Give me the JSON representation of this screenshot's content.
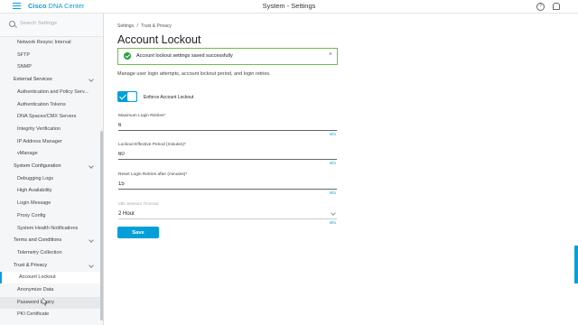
{
  "app": {
    "logo_brand": "Cisco",
    "logo_product": "DNA Center",
    "title": "System - Settings",
    "help_glyph": "?",
    "colors": {
      "accent": "#049fd9",
      "success": "#2c9d3c"
    }
  },
  "sidebar": {
    "search_placeholder": "Search Settings",
    "items": [
      {
        "label": "Network Resync Interval",
        "type": "sub"
      },
      {
        "label": "SFTP",
        "type": "sub"
      },
      {
        "label": "SNMP",
        "type": "sub"
      },
      {
        "label": "External Services",
        "type": "group"
      },
      {
        "label": "Authentication and Policy Serv...",
        "type": "sub"
      },
      {
        "label": "Authentication Tokens",
        "type": "sub"
      },
      {
        "label": "DNA Spaces/CMX Servers",
        "type": "sub"
      },
      {
        "label": "Integrity Verification",
        "type": "sub"
      },
      {
        "label": "IP Address Manager",
        "type": "sub"
      },
      {
        "label": "vManage",
        "type": "sub"
      },
      {
        "label": "System Configuration",
        "type": "group"
      },
      {
        "label": "Debugging Logs",
        "type": "sub"
      },
      {
        "label": "High Availability",
        "type": "sub"
      },
      {
        "label": "Login Message",
        "type": "sub"
      },
      {
        "label": "Proxy Config",
        "type": "sub"
      },
      {
        "label": "System Health Notifications",
        "type": "sub"
      },
      {
        "label": "Terms and Conditions",
        "type": "group"
      },
      {
        "label": "Telemetry Collection",
        "type": "sub"
      },
      {
        "label": "Trust & Privacy",
        "type": "group"
      },
      {
        "label": "Account Lockout",
        "type": "sub",
        "state": "active"
      },
      {
        "label": "Anonymize Data",
        "type": "sub"
      },
      {
        "label": "Password Expiry",
        "type": "sub",
        "state": "hover"
      },
      {
        "label": "PKI Certificate",
        "type": "sub"
      }
    ]
  },
  "main": {
    "breadcrumb": [
      "Settings",
      "/",
      "Trust & Privacy"
    ],
    "page_title": "Account Lockout",
    "alert": {
      "text": "Account lockout settings saved successfully",
      "close": "×"
    },
    "description": "Manage user login attempts, account lockout period, and login retries.",
    "toggle": {
      "label": "Enforce Account Lockout",
      "enabled": true
    },
    "fields": {
      "max_retries": {
        "label": "Maximum Login Retries*",
        "value": "6",
        "info": "Info"
      },
      "lockout_period": {
        "label": "Lockout Effective Period (minutes)*",
        "value": "60",
        "info": "Info"
      },
      "reset_retries": {
        "label": "Reset Login Retries after (minutes)*",
        "value": "15",
        "info": "Info"
      },
      "idle_timeout": {
        "label": "Idle Session Timeout",
        "value": "2 Hour",
        "info": "Info"
      }
    },
    "save_label": "Save"
  }
}
